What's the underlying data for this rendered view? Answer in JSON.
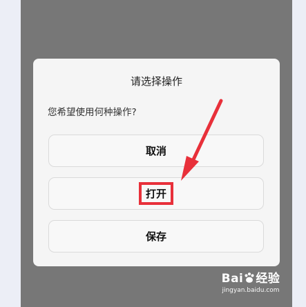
{
  "dialog": {
    "title": "请选择操作",
    "message": "您希望使用何种操作?",
    "buttons": {
      "cancel": "取消",
      "open": "打开",
      "save": "保存"
    }
  },
  "annotation": {
    "highlight_color": "#e8303a"
  },
  "watermark": {
    "brand_left": "Bai",
    "brand_right": "经验",
    "url": "jingyan.baidu.com"
  }
}
